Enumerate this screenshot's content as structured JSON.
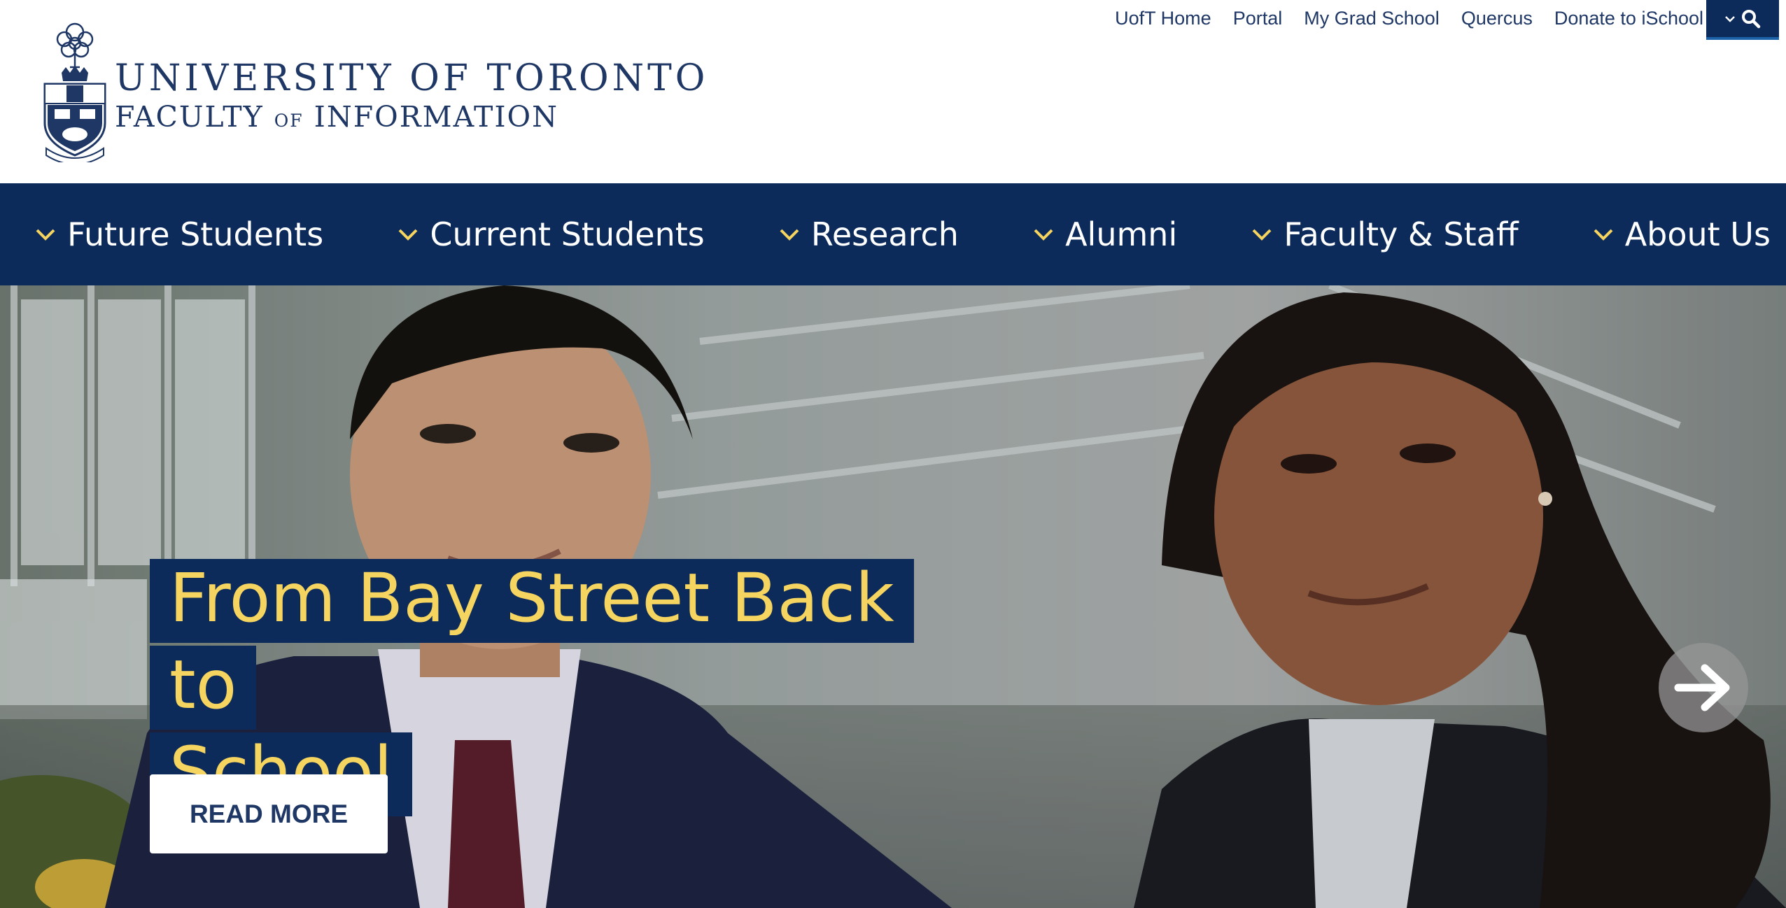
{
  "header": {
    "logo_alt": "University of Toronto Faculty of Information",
    "wordmark": {
      "line1": "UNIVERSITY OF TORONTO",
      "line2_a": "FACULTY",
      "line2_of": "OF",
      "line2_b": "INFORMATION"
    },
    "utility_links": [
      "UofT Home",
      "Portal",
      "My Grad School",
      "Quercus",
      "Donate to iSchool"
    ],
    "search_icon": "search-icon"
  },
  "main_nav": {
    "items": [
      "Future Students",
      "Current Students",
      "Research",
      "Alumni",
      "Faculty & Staff",
      "About Us"
    ],
    "chevron_icon": "chevron-down-icon"
  },
  "hero": {
    "headline_line1": "From Bay Street Back to",
    "headline_line2": "School",
    "cta_label": "READ MORE",
    "next_icon": "arrow-right-icon"
  },
  "colors": {
    "navy": "#0c2a5a",
    "brand_blue": "#1e3765",
    "gold": "#f5d45f",
    "white": "#ffffff"
  }
}
